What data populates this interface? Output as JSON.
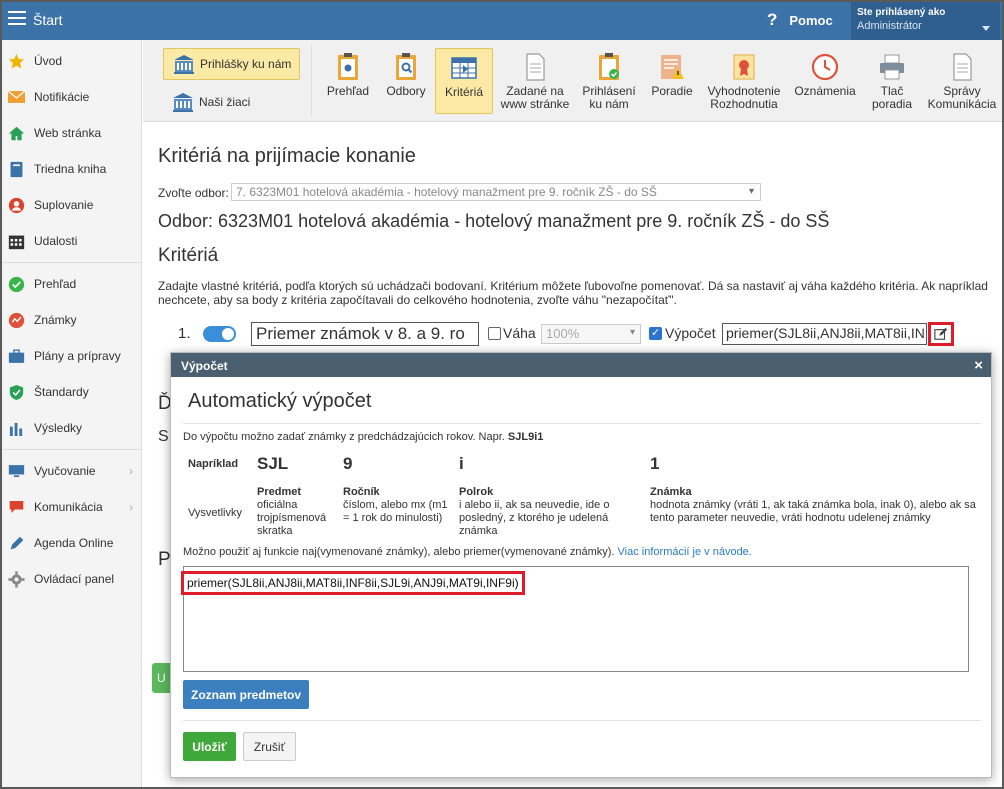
{
  "topbar": {
    "brand": "Štart",
    "help": "Pomoc",
    "help_symbol": "?",
    "user_line1": "Ste prihlásený ako",
    "user_line2": "Administrátor"
  },
  "sidebar": {
    "items": [
      {
        "label": "Úvod",
        "icon": "star-icon",
        "color": "#f0b400"
      },
      {
        "label": "Notifikácie",
        "icon": "envelope-icon",
        "color": "#f0a030"
      },
      {
        "label": "Web stránka",
        "icon": "home-icon",
        "color": "#2aa057"
      },
      {
        "label": "Triedna kniha",
        "icon": "book-icon",
        "color": "#3b72a8"
      },
      {
        "label": "Suplovanie",
        "icon": "person-icon",
        "color": "#d9432e"
      },
      {
        "label": "Udalosti",
        "icon": "calendar-icon",
        "color": "#333333"
      },
      {
        "label": "Prehľad",
        "icon": "check-circle-icon",
        "color": "#39b54a"
      },
      {
        "label": "Známky",
        "icon": "chart-circle-icon",
        "color": "#e0513b"
      },
      {
        "label": "Plány a prípravy",
        "icon": "briefcase-icon",
        "color": "#3b72a8"
      },
      {
        "label": "Štandardy",
        "icon": "shield-icon",
        "color": "#2aa057"
      },
      {
        "label": "Výsledky",
        "icon": "bar-chart-icon",
        "color": "#3b72a8"
      },
      {
        "label": "Vyučovanie",
        "icon": "monitor-icon",
        "color": "#3b72a8"
      },
      {
        "label": "Komunikácia",
        "icon": "chat-icon",
        "color": "#d9432e"
      },
      {
        "label": "Agenda Online",
        "icon": "pen-icon",
        "color": "#3b72a8"
      },
      {
        "label": "Ovládací panel",
        "icon": "gear-icon",
        "color": "#888888"
      }
    ]
  },
  "toolbar": {
    "prihlasky": "Prihlášky ku nám",
    "nasi_ziaci": "Naši žiaci",
    "buttons": [
      {
        "l1": "Prehľad",
        "l2": ""
      },
      {
        "l1": "Odbory",
        "l2": ""
      },
      {
        "l1": "Kritériá",
        "l2": ""
      },
      {
        "l1": "Zadané na",
        "l2": "www stránke"
      },
      {
        "l1": "Prihlásení",
        "l2": "ku nám"
      },
      {
        "l1": "Poradie",
        "l2": ""
      },
      {
        "l1": "Vyhodnotenie",
        "l2": "Rozhodnutia"
      },
      {
        "l1": "Oznámenia",
        "l2": ""
      },
      {
        "l1": "Tlač",
        "l2": "poradia"
      },
      {
        "l1": "Správy",
        "l2": "Komunikácia"
      }
    ]
  },
  "main": {
    "title": "Kritériá na prijímacie konanie",
    "odbor_label": "Zvoľte odbor:",
    "odbor_value": "7. 6323M01 hotelová akadémia - hotelový manažment pre 9. ročník ZŠ - do SŠ",
    "odbor_heading": "Odbor: 6323M01 hotelová akadémia - hotelový manažment pre 9. ročník ZŠ - do SŠ",
    "kriteria_heading": "Kritériá",
    "kriteria_desc": "Zadajte vlastné kritériá, podľa ktorých sú uchádzači bodovaní. Kritérium môžete ľubovoľne pomenovať. Dá sa nastaviť aj váha každého kritéria. Ak napríklad nechcete, aby sa body z kritéria započítavali do celkového hodnotenia, zvoľte váhu \"nezapočítať\".",
    "row1": {
      "number": "1.",
      "name": "Priemer známok v 8. a 9. ro",
      "vaha_label": "Váha",
      "vaha_value": "100%",
      "vypocet_label": "Výpočet",
      "vypocet_value": "priemer(SJL8ii,ANJ8ii,MAT8ii,IN"
    },
    "frag_d": "Ď",
    "frag_s": "S",
    "frag_p": "P",
    "frag_u": "U"
  },
  "modal": {
    "header": "Výpočet",
    "close": "×",
    "title": "Automatický výpočet",
    "intro": "Do výpočtu možno zadať známky z predchádzajúcich rokov. Napr.",
    "intro_example": "SJL9i1",
    "example_label": "Napríklad",
    "example_parts": [
      "SJL",
      "9",
      "i",
      "1"
    ],
    "legend_label": "Vysvetlivky",
    "legend": [
      {
        "head": "Predmet",
        "text": "oficiálna trojpísmenová skratka"
      },
      {
        "head": "Ročník",
        "text": "číslom, alebo mx (m1 = 1 rok do minulosti)"
      },
      {
        "head": "Polrok",
        "text": "i alebo ii, ak sa neuvedie, ide o posledný, z ktorého je udelená známka"
      },
      {
        "head": "Známka",
        "text": "hodnota známky (vráti 1, ak taká známka bola, inak 0), alebo ak sa tento parameter neuvedie, vráti hodnotu udelenej známky"
      }
    ],
    "note": "Možno použiť aj funkcie naj(vymenované známky), alebo priemer(vymenované známky).",
    "note_link": "Viac informácií je v návode.",
    "formula": "priemer(SJL8ii,ANJ8ii,MAT8ii,INF8ii,SJL9i,ANJ9i,MAT9i,INF9i)",
    "btn_list": "Zoznam predmetov",
    "btn_save": "Uložiť",
    "btn_cancel": "Zrušiť"
  }
}
